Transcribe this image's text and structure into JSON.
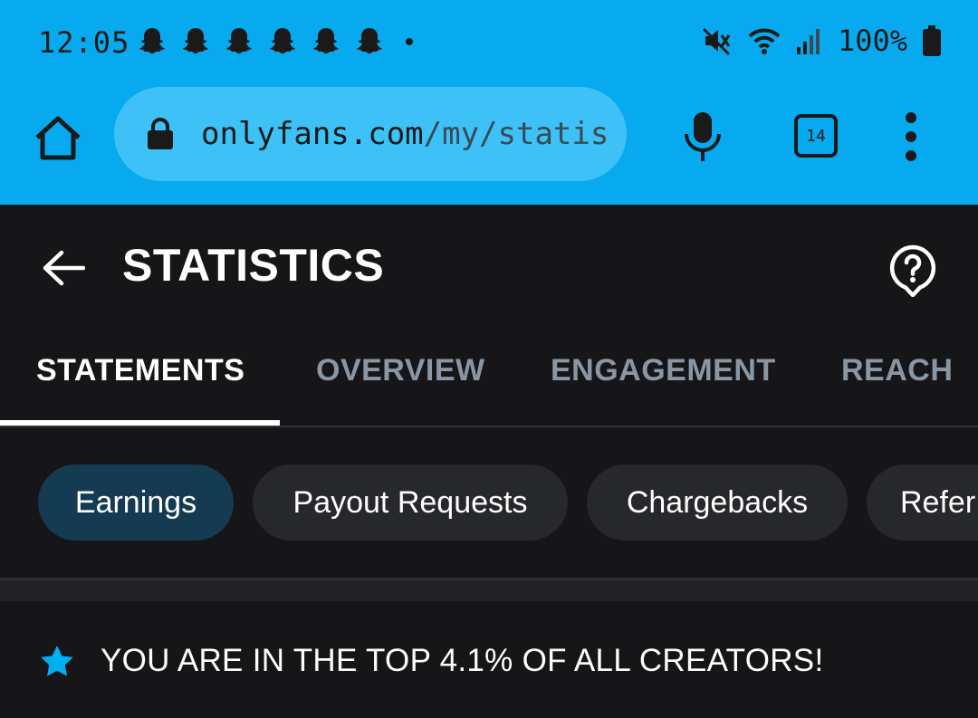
{
  "status_bar": {
    "time": "12:05",
    "notification_icons": [
      "snapchat-icon",
      "snapchat-icon",
      "snapchat-icon",
      "snapchat-icon",
      "snapchat-icon",
      "snapchat-icon"
    ],
    "battery": "100%"
  },
  "browser": {
    "url_domain": "onlyfans.com",
    "url_path": "/my/statis",
    "tab_count": "14"
  },
  "header": {
    "title": "STATISTICS"
  },
  "tabs": [
    {
      "label": "STATEMENTS",
      "active": true
    },
    {
      "label": "OVERVIEW",
      "active": false
    },
    {
      "label": "ENGAGEMENT",
      "active": false
    },
    {
      "label": "REACH",
      "active": false
    }
  ],
  "chips": [
    {
      "label": "Earnings",
      "active": true
    },
    {
      "label": "Payout Requests",
      "active": false
    },
    {
      "label": "Chargebacks",
      "active": false
    },
    {
      "label": "Refer",
      "active": false
    }
  ],
  "banner": {
    "text": "YOU ARE IN THE TOP 4.1% OF ALL CREATORS!"
  },
  "colors": {
    "browser_bar": "#08aaef",
    "url_box": "#3dc1f7",
    "background": "#161618",
    "active_chip": "#143b52",
    "star": "#00aff0"
  }
}
